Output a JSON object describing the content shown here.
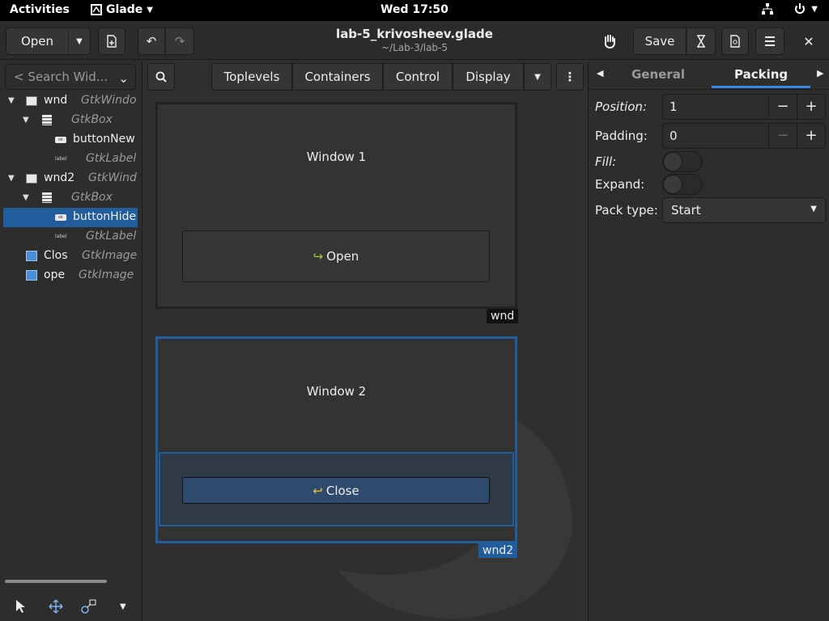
{
  "topbar": {
    "activities": "Activities",
    "app": "Glade",
    "clock": "Wed 17:50"
  },
  "header": {
    "open_label": "Open",
    "title": "lab-5_krivosheev.glade",
    "subtitle": "~/Lab-3/lab-5",
    "save_label": "Save"
  },
  "left": {
    "search_placeholder": "< Search Wid...",
    "tree": [
      {
        "name": "wnd",
        "type": "GtkWindo"
      },
      {
        "name": "",
        "type": "GtkBox"
      },
      {
        "name": "buttonNew",
        "type": ""
      },
      {
        "name": "",
        "type": "GtkLabel"
      },
      {
        "name": "wnd2",
        "type": "GtkWind"
      },
      {
        "name": "",
        "type": "GtkBox"
      },
      {
        "name": "buttonHide",
        "type": ""
      },
      {
        "name": "",
        "type": "GtkLabel"
      },
      {
        "name": "Clos",
        "type": "GtkImage"
      },
      {
        "name": "ope",
        "type": "GtkImage"
      }
    ]
  },
  "palette": {
    "tabs": [
      "Toplevels",
      "Containers",
      "Control",
      "Display"
    ]
  },
  "canvas": {
    "window1": {
      "title": "Window 1",
      "button": "Open",
      "tag": "wnd"
    },
    "window2": {
      "title": "Window 2",
      "button": "Close",
      "tag": "wnd2"
    }
  },
  "inspector": {
    "tab_general": "General",
    "tab_packing": "Packing",
    "position_label": "Position:",
    "position_value": "1",
    "padding_label": "Padding:",
    "padding_value": "0",
    "fill_label": "Fill:",
    "expand_label": "Expand:",
    "packtype_label": "Pack type:",
    "packtype_value": "Start"
  },
  "colors": {
    "accent": "#3584e4",
    "selection": "#215d9c"
  }
}
